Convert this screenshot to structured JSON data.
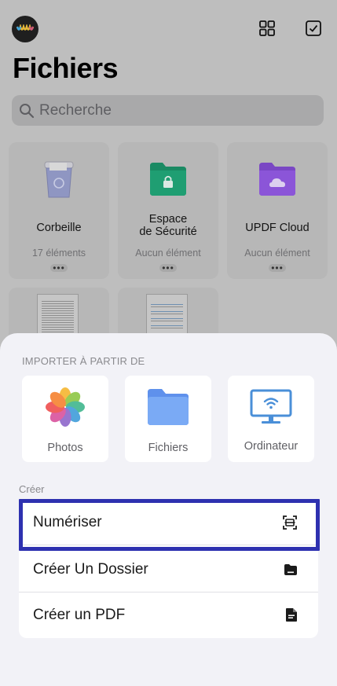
{
  "page": {
    "title": "Fichiers"
  },
  "search": {
    "placeholder": "Recherche"
  },
  "folders": [
    {
      "name": "Corbeille",
      "count": "17 éléments",
      "icon": "trash-icon"
    },
    {
      "name": "Espace\nde Sécurité",
      "count": "Aucun élément",
      "icon": "secure-folder-icon"
    },
    {
      "name": "UPDF Cloud",
      "count": "Aucun élément",
      "icon": "cloud-folder-icon"
    }
  ],
  "more_label": "•••",
  "import": {
    "heading": "IMPORTER À PARTIR DE",
    "sources": [
      {
        "label": "Photos",
        "icon": "photos-icon"
      },
      {
        "label": "Fichiers",
        "icon": "files-folder-icon"
      },
      {
        "label": "Ordinateur",
        "icon": "computer-wifi-icon"
      }
    ]
  },
  "create": {
    "heading": "Créer",
    "items": [
      {
        "label": "Numériser",
        "icon": "scan-icon"
      },
      {
        "label": "Créer Un Dossier",
        "icon": "folder-icon"
      },
      {
        "label": "Créer un PDF",
        "icon": "pdf-file-icon"
      }
    ]
  },
  "colors": {
    "highlight": "#2e31b0",
    "secure_folder": "#1f9e72",
    "cloud_folder": "#8b55d8",
    "files_folder": "#6f9ff2",
    "computer": "#4a8fd8"
  }
}
